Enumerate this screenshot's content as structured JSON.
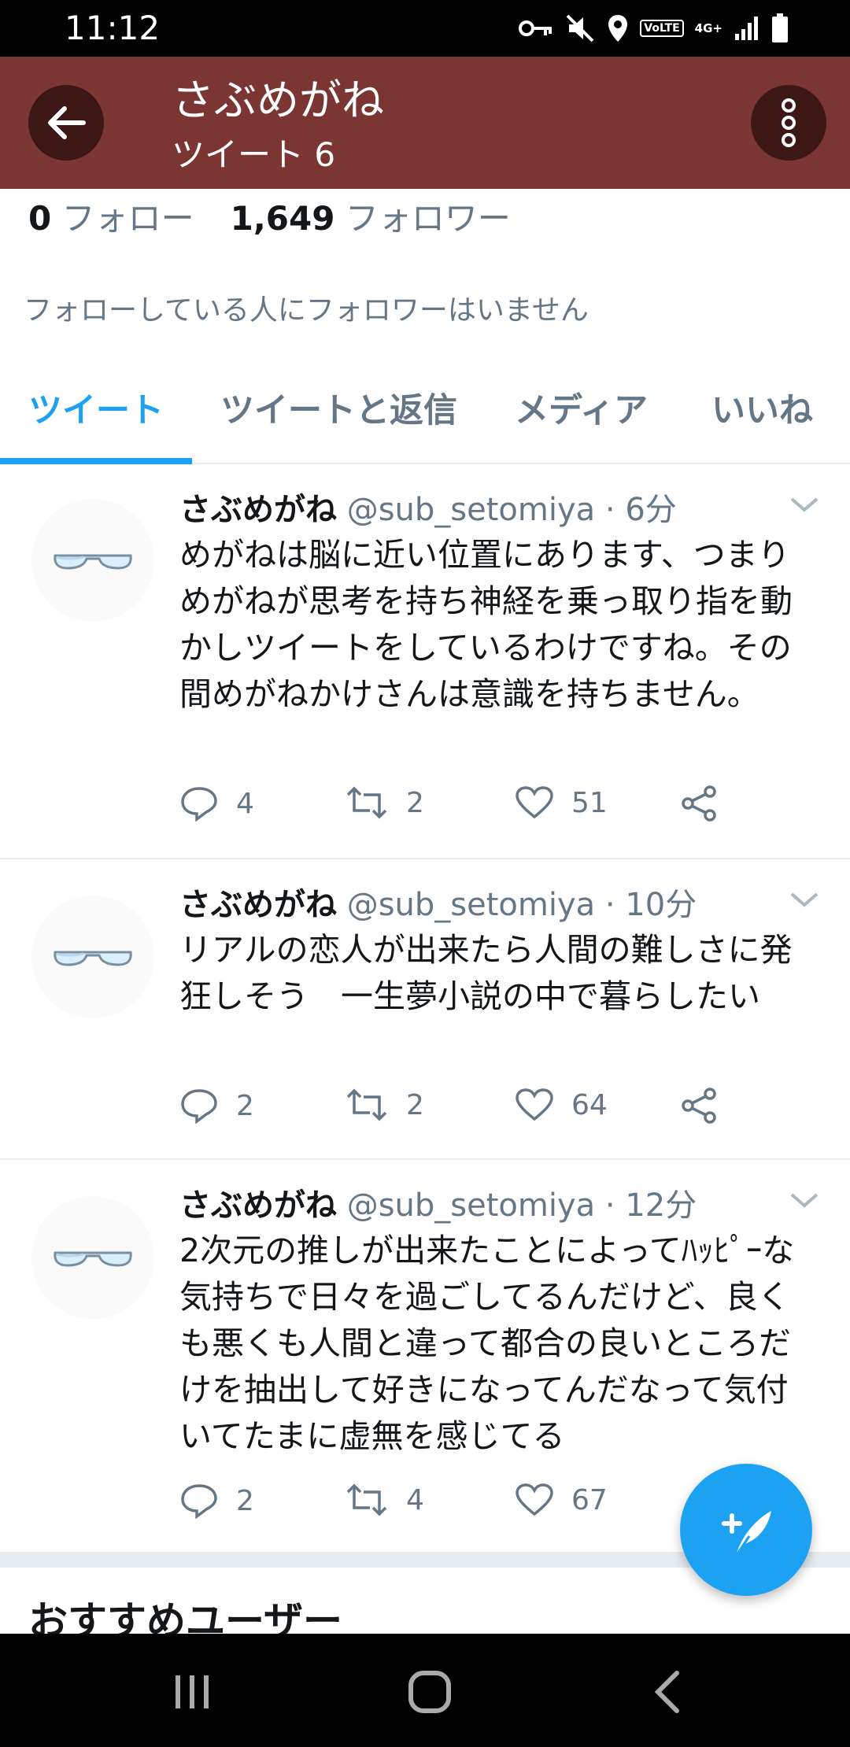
{
  "status_bar": {
    "time": "11:12",
    "icons": [
      "key-icon",
      "mute-icon",
      "location-icon",
      "volte-icon",
      "4g-icon",
      "signal-icon",
      "battery-icon"
    ],
    "volte_label": "VoLTE",
    "network_label": "4G+"
  },
  "app_bar": {
    "title": "さぶめがね",
    "subtitle": "ツイート 6",
    "color": "#7b3634"
  },
  "profile": {
    "following_count": "0",
    "following_label": "フォロー",
    "followers_count": "1,649",
    "followers_label": "フォロワー",
    "known_followers_text": "フォローしている人にフォロワーはいません"
  },
  "tabs": [
    {
      "label": "ツイート",
      "active": true
    },
    {
      "label": "ツイートと返信",
      "active": false
    },
    {
      "label": "メディア",
      "active": false
    },
    {
      "label": "いいね",
      "active": false
    }
  ],
  "tweets": [
    {
      "name": "さぶめがね",
      "handle": "@sub_setomiya",
      "dot": "·",
      "time": "6分",
      "text": "めがねは脳に近い位置にあります、つまりめがねが思考を持ち神経を乗っ取り指を動かしツイートをしているわけですね。その間めがねかけさんは意識を持ちません。",
      "replies": "4",
      "retweets": "2",
      "likes": "51"
    },
    {
      "name": "さぶめがね",
      "handle": "@sub_setomiya",
      "dot": "·",
      "time": "10分",
      "text": "リアルの恋人が出来たら人間の難しさに発狂しそう　一生夢小説の中で暮らしたい",
      "replies": "2",
      "retweets": "2",
      "likes": "64"
    },
    {
      "name": "さぶめがね",
      "handle": "@sub_setomiya",
      "dot": "·",
      "time": "12分",
      "text": "2次元の推しが出来たことによってﾊｯﾋﾟｰな気持ちで日々を過ごしてるんだけど、良くも悪くも人間と違って都合の良いところだけを抽出して好きになってんだなって気付いてたまに虚無を感じてる",
      "replies": "2",
      "retweets": "4",
      "likes": "67"
    }
  ],
  "suggestions": {
    "title": "おすすめユーザー"
  },
  "colors": {
    "accent": "#1da1f2",
    "muted_text": "#657786",
    "divider": "#e6ecf0"
  }
}
